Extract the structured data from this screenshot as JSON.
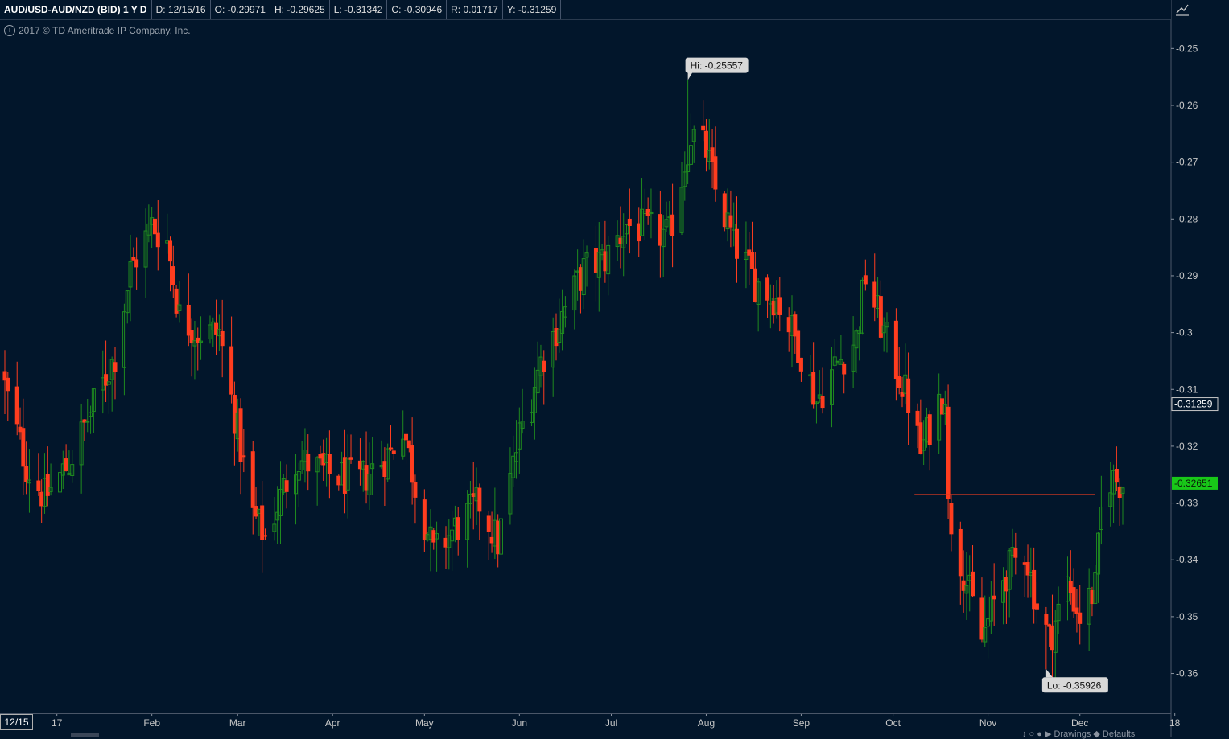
{
  "header": {
    "symbol": "AUD/USD-AUD/NZD (BID) 1 Y D",
    "date": "D: 12/15/16",
    "open": "O: -0.29971",
    "high": "H: -0.29625",
    "low": "L: -0.31342",
    "close": "C: -0.30946",
    "range": "R: 0.01717",
    "y": "Y: -0.31259"
  },
  "copyright": "2017 © TD Ameritrade IP Company, Inc.",
  "cursor_date_tag": "12/15",
  "bottom_controls": "↕ ○ ● ▶   Drawings   ◆ Defaults",
  "colors": {
    "background": "#02162b",
    "up": "#1f8a1f",
    "down": "#ff3d1f",
    "crosshair": "#c8c8c8",
    "current_badge": "#18c818",
    "hline": "#e03b20"
  },
  "chart_data": {
    "type": "candlestick",
    "ylim": [
      -0.367,
      -0.245
    ],
    "yticks": [
      "-0.25",
      "-0.26",
      "-0.27",
      "-0.28",
      "-0.29",
      "-0.3",
      "-0.31",
      "-0.32",
      "-0.33",
      "-0.34",
      "-0.35",
      "-0.36"
    ],
    "ytick_values": [
      -0.25,
      -0.26,
      -0.27,
      -0.28,
      -0.29,
      -0.3,
      -0.31,
      -0.32,
      -0.33,
      -0.34,
      -0.35,
      -0.36
    ],
    "xticks": [
      "17",
      "Feb",
      "Mar",
      "Apr",
      "May",
      "Jun",
      "Jul",
      "Aug",
      "Sep",
      "Oct",
      "Nov",
      "Dec",
      "18"
    ],
    "xtick_dates": [
      "2017-01-01",
      "2017-02-01",
      "2017-03-01",
      "2017-04-01",
      "2017-05-01",
      "2017-06-01",
      "2017-07-01",
      "2017-08-01",
      "2017-09-01",
      "2017-10-01",
      "2017-11-01",
      "2017-12-01",
      "2018-01-01"
    ],
    "start_date": "2016-12-15",
    "end_date": "2017-12-15",
    "path_closes": [
      {
        "date": "2016-12-15",
        "close": -0.30946
      },
      {
        "date": "2016-12-22",
        "close": -0.3235
      },
      {
        "date": "2016-12-28",
        "close": -0.329
      },
      {
        "date": "2017-01-05",
        "close": -0.323
      },
      {
        "date": "2017-01-12",
        "close": -0.314
      },
      {
        "date": "2017-01-20",
        "close": -0.304
      },
      {
        "date": "2017-01-25",
        "close": -0.289
      },
      {
        "date": "2017-02-01",
        "close": -0.281
      },
      {
        "date": "2017-02-06",
        "close": -0.284
      },
      {
        "date": "2017-02-10",
        "close": -0.297
      },
      {
        "date": "2017-02-16",
        "close": -0.3
      },
      {
        "date": "2017-02-23",
        "close": -0.3
      },
      {
        "date": "2017-03-06",
        "close": -0.332
      },
      {
        "date": "2017-03-10",
        "close": -0.336
      },
      {
        "date": "2017-03-20",
        "close": -0.322
      },
      {
        "date": "2017-03-31",
        "close": -0.325
      },
      {
        "date": "2017-04-10",
        "close": -0.326
      },
      {
        "date": "2017-04-20",
        "close": -0.321
      },
      {
        "date": "2017-04-24",
        "close": -0.316
      },
      {
        "date": "2017-04-28",
        "close": -0.327
      },
      {
        "date": "2017-05-04",
        "close": -0.339
      },
      {
        "date": "2017-05-10",
        "close": -0.335
      },
      {
        "date": "2017-05-19",
        "close": -0.33
      },
      {
        "date": "2017-05-25",
        "close": -0.337
      },
      {
        "date": "2017-06-01",
        "close": -0.318
      },
      {
        "date": "2017-06-08",
        "close": -0.305
      },
      {
        "date": "2017-06-15",
        "close": -0.297
      },
      {
        "date": "2017-06-22",
        "close": -0.289
      },
      {
        "date": "2017-06-29",
        "close": -0.287
      },
      {
        "date": "2017-07-06",
        "close": -0.281
      },
      {
        "date": "2017-07-13",
        "close": -0.282
      },
      {
        "date": "2017-07-20",
        "close": -0.283
      },
      {
        "date": "2017-07-27",
        "close": -0.265
      },
      {
        "date": "2017-08-01",
        "close": -0.268
      },
      {
        "date": "2017-08-04",
        "close": -0.275
      },
      {
        "date": "2017-08-10",
        "close": -0.284
      },
      {
        "date": "2017-08-17",
        "close": -0.291
      },
      {
        "date": "2017-08-24",
        "close": -0.294
      },
      {
        "date": "2017-08-31",
        "close": -0.302
      },
      {
        "date": "2017-09-06",
        "close": -0.312
      },
      {
        "date": "2017-09-12",
        "close": -0.306
      },
      {
        "date": "2017-09-19",
        "close": -0.301
      },
      {
        "date": "2017-09-22",
        "close": -0.29
      },
      {
        "date": "2017-09-28",
        "close": -0.3
      },
      {
        "date": "2017-10-06",
        "close": -0.312
      },
      {
        "date": "2017-10-10",
        "close": -0.321
      },
      {
        "date": "2017-10-16",
        "close": -0.312
      },
      {
        "date": "2017-10-18",
        "close": -0.31
      },
      {
        "date": "2017-10-19",
        "close": -0.331
      },
      {
        "date": "2017-10-24",
        "close": -0.342
      },
      {
        "date": "2017-10-30",
        "close": -0.354
      },
      {
        "date": "2017-11-06",
        "close": -0.343
      },
      {
        "date": "2017-11-13",
        "close": -0.338
      },
      {
        "date": "2017-11-17",
        "close": -0.348
      },
      {
        "date": "2017-11-21",
        "close": -0.354
      },
      {
        "date": "2017-11-27",
        "close": -0.344
      },
      {
        "date": "2017-12-01",
        "close": -0.35
      },
      {
        "date": "2017-12-06",
        "close": -0.345
      },
      {
        "date": "2017-12-09",
        "close": -0.325
      },
      {
        "date": "2017-12-15",
        "close": -0.32651
      }
    ],
    "hi_label": "Hi: -0.25557",
    "hi_value": -0.25557,
    "hi_date": "2017-07-26",
    "lo_label": "Lo: -0.35926",
    "lo_value": -0.35926,
    "lo_date": "2017-11-20",
    "crosshair_label": "-0.31259",
    "crosshair_value": -0.31259,
    "current_label": "-0.32651",
    "current_value": -0.32651,
    "hline": {
      "value": -0.3285,
      "start_date": "2017-10-08",
      "end_date": "2017-12-06"
    },
    "grid": false
  }
}
